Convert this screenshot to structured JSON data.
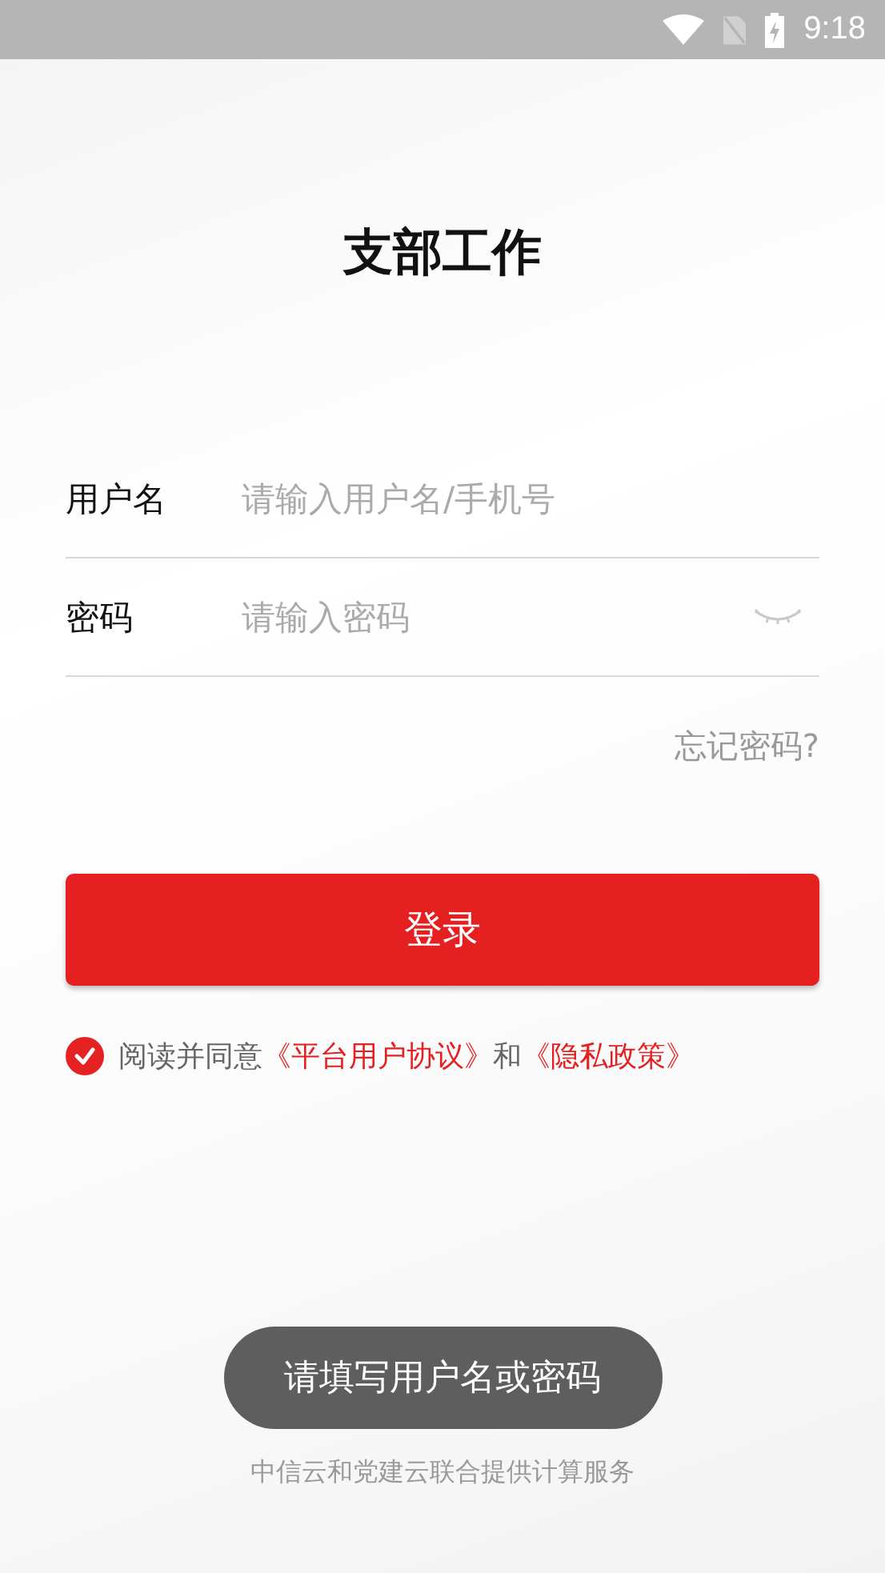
{
  "status_bar": {
    "time": "9:18"
  },
  "title": "支部工作",
  "fields": [
    {
      "label": "用户名",
      "placeholder": "请输入用户名/手机号",
      "kind": "text"
    },
    {
      "label": "密码",
      "placeholder": "请输入密码",
      "kind": "password"
    }
  ],
  "forgot_link": "忘记密码?",
  "login_button": "登录",
  "agreement": {
    "checked": true,
    "prefix": "阅读并同意",
    "link_1": "《平台用户协议》",
    "joiner": "和",
    "link_2": "《隐私政策》"
  },
  "footer": "中信云和党建云联合提供计算服务",
  "toast": "请填写用户名或密码"
}
